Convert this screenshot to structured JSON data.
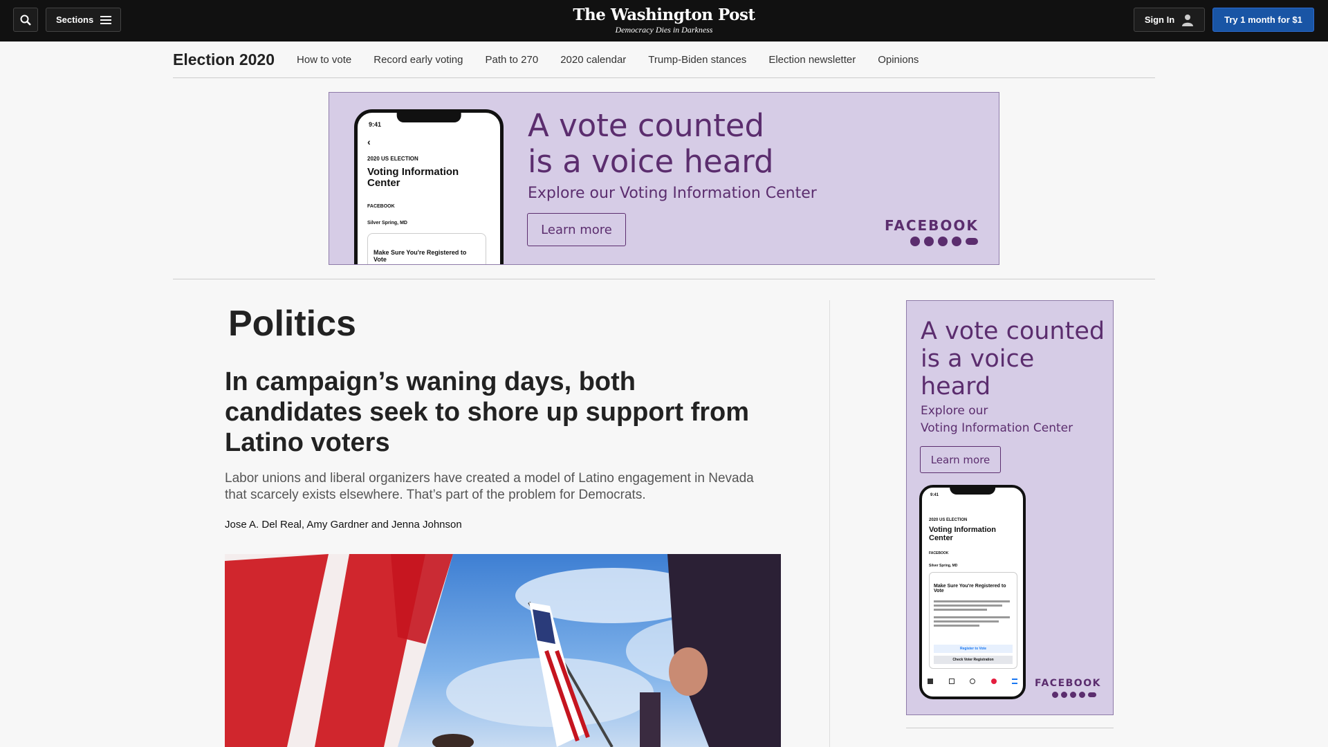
{
  "header": {
    "sections_label": "Sections",
    "logo_name": "The Washington Post",
    "logo_tagline": "Democracy Dies in Darkness",
    "signin_label": "Sign In",
    "try_label": "Try 1 month for $1"
  },
  "subnav": {
    "title": "Election 2020",
    "links": [
      "How to vote",
      "Record early voting",
      "Path to 270",
      "2020 calendar",
      "Trump-Biden stances",
      "Election newsletter",
      "Opinions"
    ]
  },
  "ad_top": {
    "headline_1": "A vote counted",
    "headline_2": "is a voice heard",
    "sub": "Explore our Voting Information Center",
    "cta": "Learn more",
    "brand": "FACEBOOK",
    "phone": {
      "time": "9:41",
      "kicker": "2020 US ELECTION",
      "title": "Voting Information Center",
      "brand": "FACEBOOK",
      "location": "Silver Spring, MD",
      "card_title": "Make Sure You're Registered to Vote"
    }
  },
  "article": {
    "section": "Politics",
    "headline": "In campaign’s waning days, both candidates seek to shore up support from Latino voters",
    "dek": "Labor unions and liberal organizers have created a model of Latino engagement in Nevada that scarcely exists elsewhere. That’s part of the problem for Democrats.",
    "byline": "Jose A. Del Real, Amy Gardner and Jenna Johnson"
  },
  "ad_right": {
    "headline": "A vote counted is a voice heard",
    "sub_1": "Explore our",
    "sub_2": "Voting Information Center",
    "cta": "Learn more",
    "brand": "FACEBOOK",
    "phone": {
      "time": "9:41",
      "kicker": "2020 US ELECTION",
      "title": "Voting Information Center",
      "brand": "FACEBOOK",
      "location": "Silver Spring, MD",
      "card_title": "Make Sure You're Registered to Vote",
      "btn_1": "Register to Vote",
      "btn_2": "Check Voter Registration"
    }
  }
}
